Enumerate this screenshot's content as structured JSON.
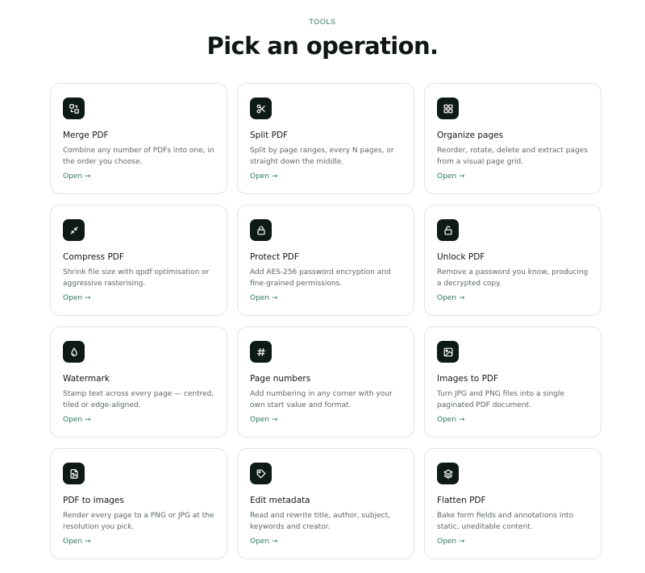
{
  "header": {
    "eyebrow": "TOOLS",
    "title": "Pick an operation."
  },
  "tools": [
    {
      "icon": "merge-icon",
      "title": "Merge PDF",
      "desc": "Combine any number of PDFs into one, in the order you choose.",
      "link": "Open →"
    },
    {
      "icon": "scissors-icon",
      "title": "Split PDF",
      "desc": "Split by page ranges, every N pages, or straight down the middle.",
      "link": "Open →"
    },
    {
      "icon": "grid-icon",
      "title": "Organize pages",
      "desc": "Reorder, rotate, delete and extract pages from a visual page grid.",
      "link": "Open →"
    },
    {
      "icon": "compress-icon",
      "title": "Compress PDF",
      "desc": "Shrink file size with qpdf optimisation or aggressive rasterising.",
      "link": "Open →"
    },
    {
      "icon": "lock-icon",
      "title": "Protect PDF",
      "desc": "Add AES-256 password encryption and fine-grained permissions.",
      "link": "Open →"
    },
    {
      "icon": "unlock-icon",
      "title": "Unlock PDF",
      "desc": "Remove a password you know, producing a decrypted copy.",
      "link": "Open →"
    },
    {
      "icon": "droplet-icon",
      "title": "Watermark",
      "desc": "Stamp text across every page — centred, tiled or edge-aligned.",
      "link": "Open →"
    },
    {
      "icon": "hash-icon",
      "title": "Page numbers",
      "desc": "Add numbering in any corner with your own start value and format.",
      "link": "Open →"
    },
    {
      "icon": "image-icon",
      "title": "Images to PDF",
      "desc": "Turn JPG and PNG files into a single paginated PDF document.",
      "link": "Open →"
    },
    {
      "icon": "file-image-icon",
      "title": "PDF to images",
      "desc": "Render every page to a PNG or JPG at the resolution you pick.",
      "link": "Open →"
    },
    {
      "icon": "tag-icon",
      "title": "Edit metadata",
      "desc": "Read and rewrite title, author, subject, keywords and creator.",
      "link": "Open →"
    },
    {
      "icon": "layers-icon",
      "title": "Flatten PDF",
      "desc": "Bake form fields and annotations into static, uneditable content.",
      "link": "Open →"
    }
  ]
}
